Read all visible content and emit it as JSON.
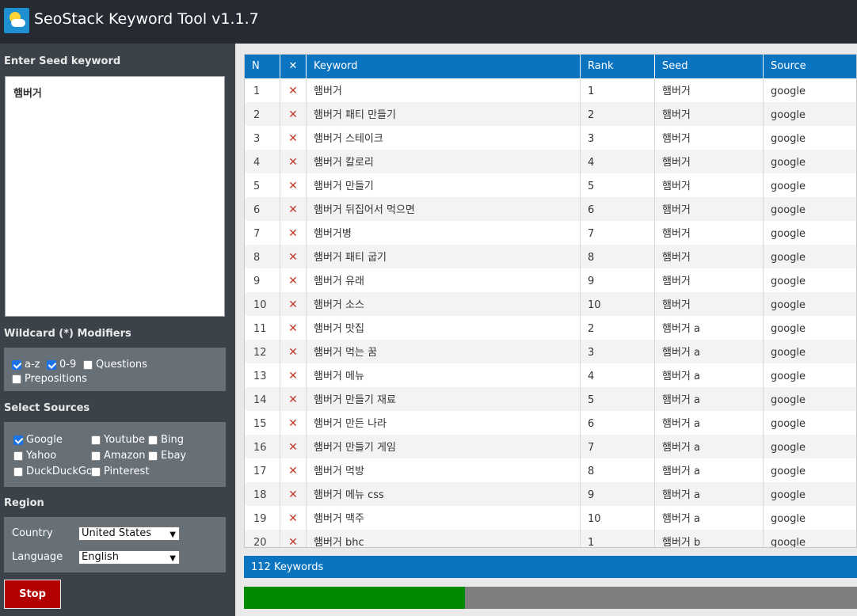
{
  "app": {
    "title": "SeoStack Keyword Tool v1.1.7",
    "icon": "sun-cloud-icon"
  },
  "seed": {
    "heading": "Enter Seed keyword",
    "value": "햄버거"
  },
  "wildcard": {
    "heading": "Wildcard (*) Modifiers",
    "options": [
      {
        "label": "a-z",
        "checked": true
      },
      {
        "label": "0-9",
        "checked": true
      },
      {
        "label": "Questions",
        "checked": false
      },
      {
        "label": "Prepositions",
        "checked": false
      }
    ]
  },
  "sources": {
    "heading": "Select Sources",
    "options": [
      {
        "label": "Google",
        "checked": true
      },
      {
        "label": "Youtube",
        "checked": false
      },
      {
        "label": "Bing",
        "checked": false
      },
      {
        "label": "Yahoo",
        "checked": false
      },
      {
        "label": "Amazon",
        "checked": false
      },
      {
        "label": "Ebay",
        "checked": false
      },
      {
        "label": "DuckDuckGo",
        "checked": false
      },
      {
        "label": "Pinterest",
        "checked": false
      }
    ]
  },
  "region": {
    "heading": "Region",
    "country_label": "Country",
    "country_value": "United States",
    "language_label": "Language",
    "language_value": "English"
  },
  "stop_label": "Stop",
  "table": {
    "headers": {
      "n": "N",
      "x": "✕",
      "keyword": "Keyword",
      "rank": "Rank",
      "seed": "Seed",
      "source": "Source"
    },
    "rows": [
      {
        "n": "1",
        "keyword": "햄버거",
        "rank": "1",
        "seed": "햄버거",
        "source": "google"
      },
      {
        "n": "2",
        "keyword": "햄버거 패티 만들기",
        "rank": "2",
        "seed": "햄버거",
        "source": "google"
      },
      {
        "n": "3",
        "keyword": "햄버거 스테이크",
        "rank": "3",
        "seed": "햄버거",
        "source": "google"
      },
      {
        "n": "4",
        "keyword": "햄버거 칼로리",
        "rank": "4",
        "seed": "햄버거",
        "source": "google"
      },
      {
        "n": "5",
        "keyword": "햄버거 만들기",
        "rank": "5",
        "seed": "햄버거",
        "source": "google"
      },
      {
        "n": "6",
        "keyword": "햄버거 뒤집어서 먹으면",
        "rank": "6",
        "seed": "햄버거",
        "source": "google"
      },
      {
        "n": "7",
        "keyword": "햄버거병",
        "rank": "7",
        "seed": "햄버거",
        "source": "google"
      },
      {
        "n": "8",
        "keyword": "햄버거 패티 굽기",
        "rank": "8",
        "seed": "햄버거",
        "source": "google"
      },
      {
        "n": "9",
        "keyword": "햄버거 유래",
        "rank": "9",
        "seed": "햄버거",
        "source": "google"
      },
      {
        "n": "10",
        "keyword": "햄버거 소스",
        "rank": "10",
        "seed": "햄버거",
        "source": "google"
      },
      {
        "n": "11",
        "keyword": "햄버거 맛집",
        "rank": "2",
        "seed": "햄버거 a",
        "source": "google"
      },
      {
        "n": "12",
        "keyword": "햄버거 먹는 꿈",
        "rank": "3",
        "seed": "햄버거 a",
        "source": "google"
      },
      {
        "n": "13",
        "keyword": "햄버거 메뉴",
        "rank": "4",
        "seed": "햄버거 a",
        "source": "google"
      },
      {
        "n": "14",
        "keyword": "햄버거 만들기 재료",
        "rank": "5",
        "seed": "햄버거 a",
        "source": "google"
      },
      {
        "n": "15",
        "keyword": "햄버거 만든 나라",
        "rank": "6",
        "seed": "햄버거 a",
        "source": "google"
      },
      {
        "n": "16",
        "keyword": "햄버거 만들기 게임",
        "rank": "7",
        "seed": "햄버거 a",
        "source": "google"
      },
      {
        "n": "17",
        "keyword": "햄버거 먹방",
        "rank": "8",
        "seed": "햄버거 a",
        "source": "google"
      },
      {
        "n": "18",
        "keyword": "햄버거 메뉴 css",
        "rank": "9",
        "seed": "햄버거 a",
        "source": "google"
      },
      {
        "n": "19",
        "keyword": "햄버거 맥주",
        "rank": "10",
        "seed": "햄버거 a",
        "source": "google"
      },
      {
        "n": "20",
        "keyword": "햄버거 bhc",
        "rank": "1",
        "seed": "햄버거 b",
        "source": "google"
      }
    ]
  },
  "status": {
    "keywords_count": "112 Keywords"
  },
  "progress": {
    "fraction": 0.36
  },
  "colors": {
    "header_blue": "#0b74c1",
    "progress_green": "#008a00",
    "stop_red": "#b30000",
    "delete_x": "#c0392b"
  }
}
